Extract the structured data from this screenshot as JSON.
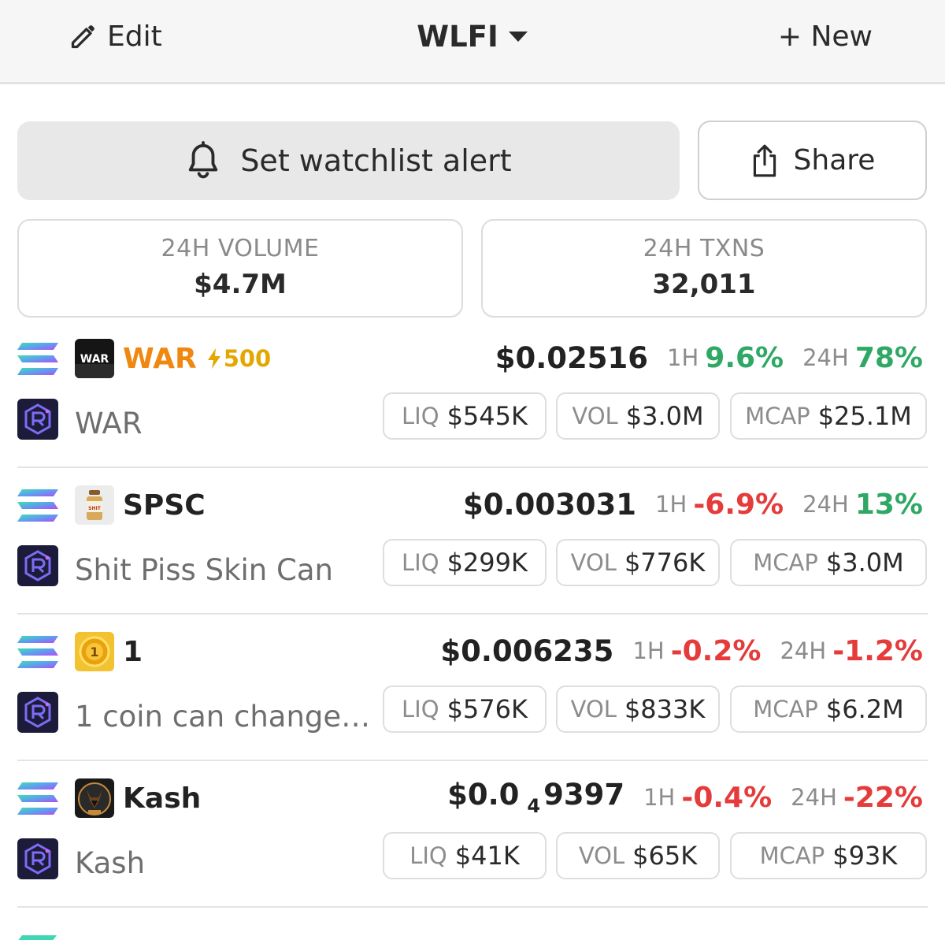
{
  "header": {
    "edit_label": "Edit",
    "title": "WLFI",
    "new_label": "+ New"
  },
  "actions": {
    "alert_label": "Set watchlist alert",
    "share_label": "Share"
  },
  "stats": [
    {
      "label": "24H VOLUME",
      "value": "$4.7M"
    },
    {
      "label": "24H TXNS",
      "value": "32,011"
    }
  ],
  "labels": {
    "liq": "LIQ",
    "vol": "VOL",
    "mcap": "MCAP",
    "h1": "1H",
    "h24": "24H"
  },
  "tokens": [
    {
      "symbol": "WAR",
      "symbol_color": "#f0870e",
      "boost": "500",
      "name": "WAR",
      "price": "$0.02516",
      "change_1h": "9.6%",
      "change_1h_dir": "pos",
      "change_24h": "78%",
      "change_24h_dir": "pos",
      "liq": "$545K",
      "vol": "$3.0M",
      "mcap": "$25.1M",
      "logo_text": "WAR",
      "logo_bg": "#151515",
      "logo_fg": "#ffffff"
    },
    {
      "symbol": "SPSC",
      "symbol_color": "#222222",
      "name": "Shit Piss Skin Can",
      "price": "$0.003031",
      "change_1h": "-6.9%",
      "change_1h_dir": "neg",
      "change_24h": "13%",
      "change_24h_dir": "pos",
      "liq": "$299K",
      "vol": "$776K",
      "mcap": "$3.0M",
      "logo_text": "SHIT PISS",
      "logo_bg": "#ececec",
      "logo_fg": "#b23a1a"
    },
    {
      "symbol": "1",
      "symbol_color": "#222222",
      "name": "1 coin can change…",
      "price": "$0.006235",
      "change_1h": "-0.2%",
      "change_1h_dir": "neg",
      "change_24h": "-1.2%",
      "change_24h_dir": "neg",
      "liq": "$576K",
      "vol": "$833K",
      "mcap": "$6.2M",
      "logo_text": "1",
      "logo_bg": "#e8a20c",
      "logo_fg": "#7a4a00"
    },
    {
      "symbol": "Kash",
      "symbol_color": "#222222",
      "name": "Kash",
      "price_main": "$0.0",
      "price_zeros": "4",
      "price_tail": "9397",
      "change_1h": "-0.4%",
      "change_1h_dir": "neg",
      "change_24h": "-22%",
      "change_24h_dir": "neg",
      "liq": "$41K",
      "vol": "$65K",
      "mcap": "$93K",
      "logo_text": "",
      "logo_bg": "#1a1a1a",
      "logo_fg": "#c58a3a"
    }
  ],
  "colors": {
    "positive": "#2fa865",
    "negative": "#e53b3b",
    "boost": "#e3a700",
    "dex_bg": "#1c1c3a",
    "dex_fg": "#7d6cf5"
  }
}
